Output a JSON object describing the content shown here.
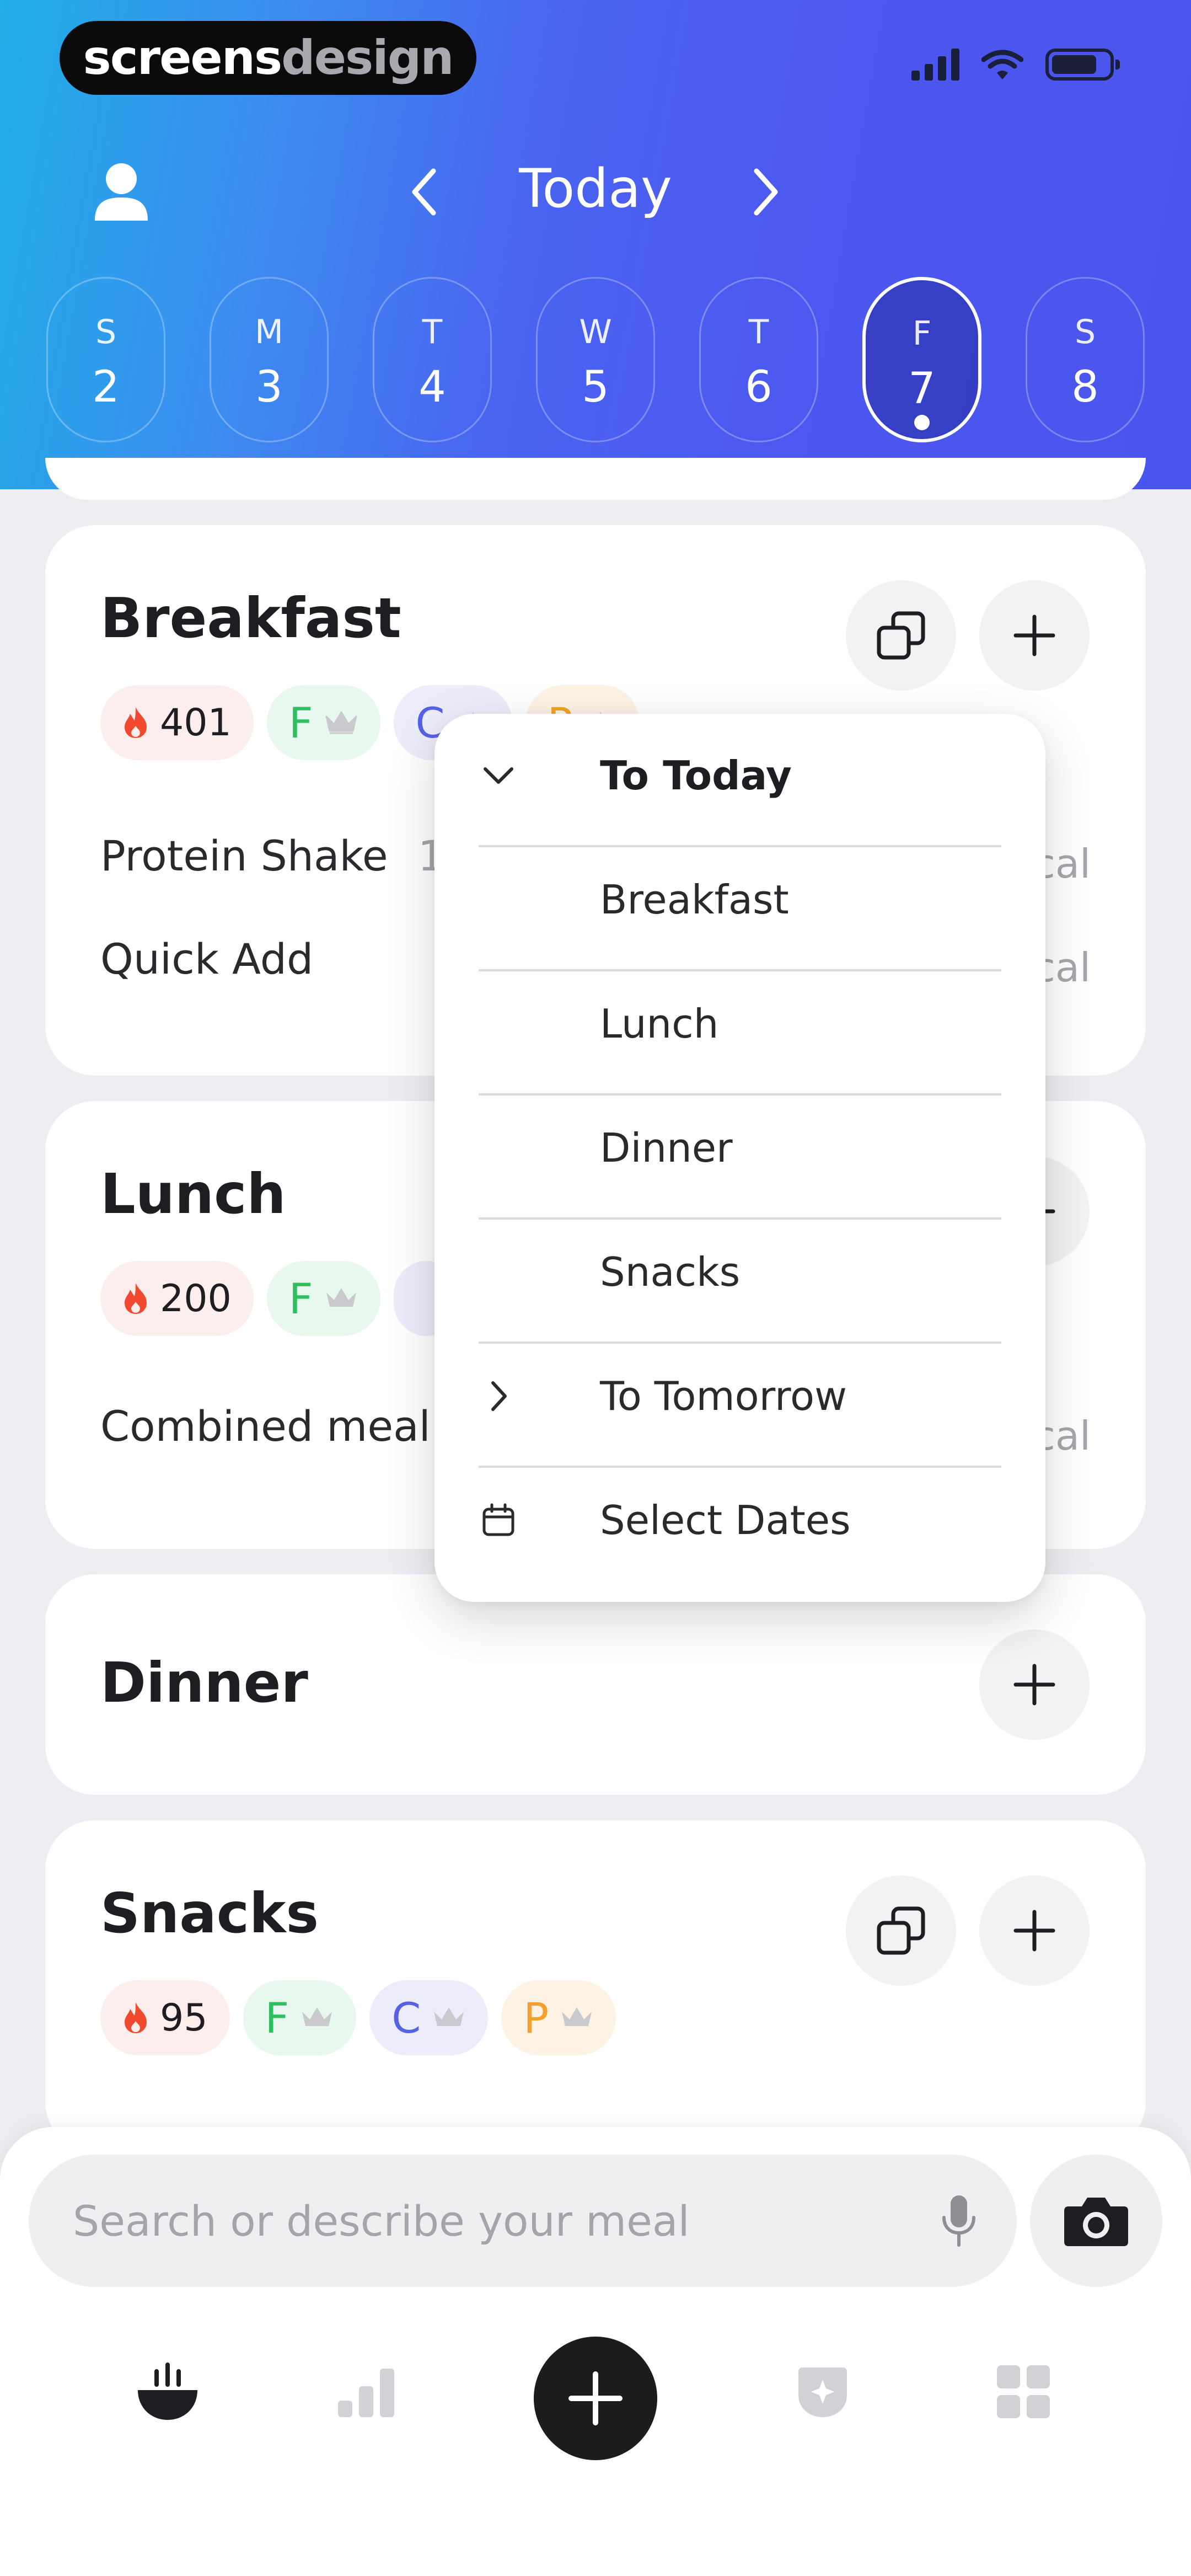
{
  "brand": {
    "part1": "screens",
    "part2": "design"
  },
  "header": {
    "title": "Today"
  },
  "days": [
    {
      "letter": "S",
      "num": "2"
    },
    {
      "letter": "M",
      "num": "3"
    },
    {
      "letter": "T",
      "num": "4"
    },
    {
      "letter": "W",
      "num": "5"
    },
    {
      "letter": "T",
      "num": "6"
    },
    {
      "letter": "F",
      "num": "7",
      "selected": true
    },
    {
      "letter": "S",
      "num": "8"
    }
  ],
  "meals": {
    "breakfast": {
      "title": "Breakfast",
      "calories": "401",
      "fat": "F",
      "carbs": "C",
      "protein": "P",
      "entries": [
        {
          "name": "Protein Shake",
          "qty": "1",
          "suffix": "cal"
        },
        {
          "name": "Quick Add",
          "suffix": "cal"
        }
      ]
    },
    "lunch": {
      "title": "Lunch",
      "calories": "200",
      "fat": "F",
      "entries": [
        {
          "name": "Combined meal",
          "suffix": "cal"
        }
      ]
    },
    "dinner": {
      "title": "Dinner"
    },
    "snacks": {
      "title": "Snacks",
      "calories": "95",
      "fat": "F",
      "carbs": "C",
      "protein": "P"
    }
  },
  "menu": {
    "to_today": "To Today",
    "breakfast": "Breakfast",
    "lunch": "Lunch",
    "dinner": "Dinner",
    "snacks": "Snacks",
    "to_tomorrow": "To Tomorrow",
    "select_dates": "Select Dates"
  },
  "search": {
    "placeholder": "Search or describe your meal"
  },
  "colors": {
    "header_start": "#1faee6",
    "header_end": "#4a55ee",
    "fat": "#2fbf5f",
    "carbs": "#5662e6",
    "protein": "#f2a12a",
    "calorie_flame": "#f0492f"
  },
  "icons": [
    "user-icon",
    "chevron-left-icon",
    "chevron-right-icon",
    "copy-icon",
    "plus-icon",
    "flame-icon",
    "crown-icon",
    "checkmark-icon",
    "calendar-icon",
    "mic-icon",
    "camera-icon",
    "bowl-icon",
    "stats-icon",
    "badge-icon",
    "grid-icon"
  ]
}
